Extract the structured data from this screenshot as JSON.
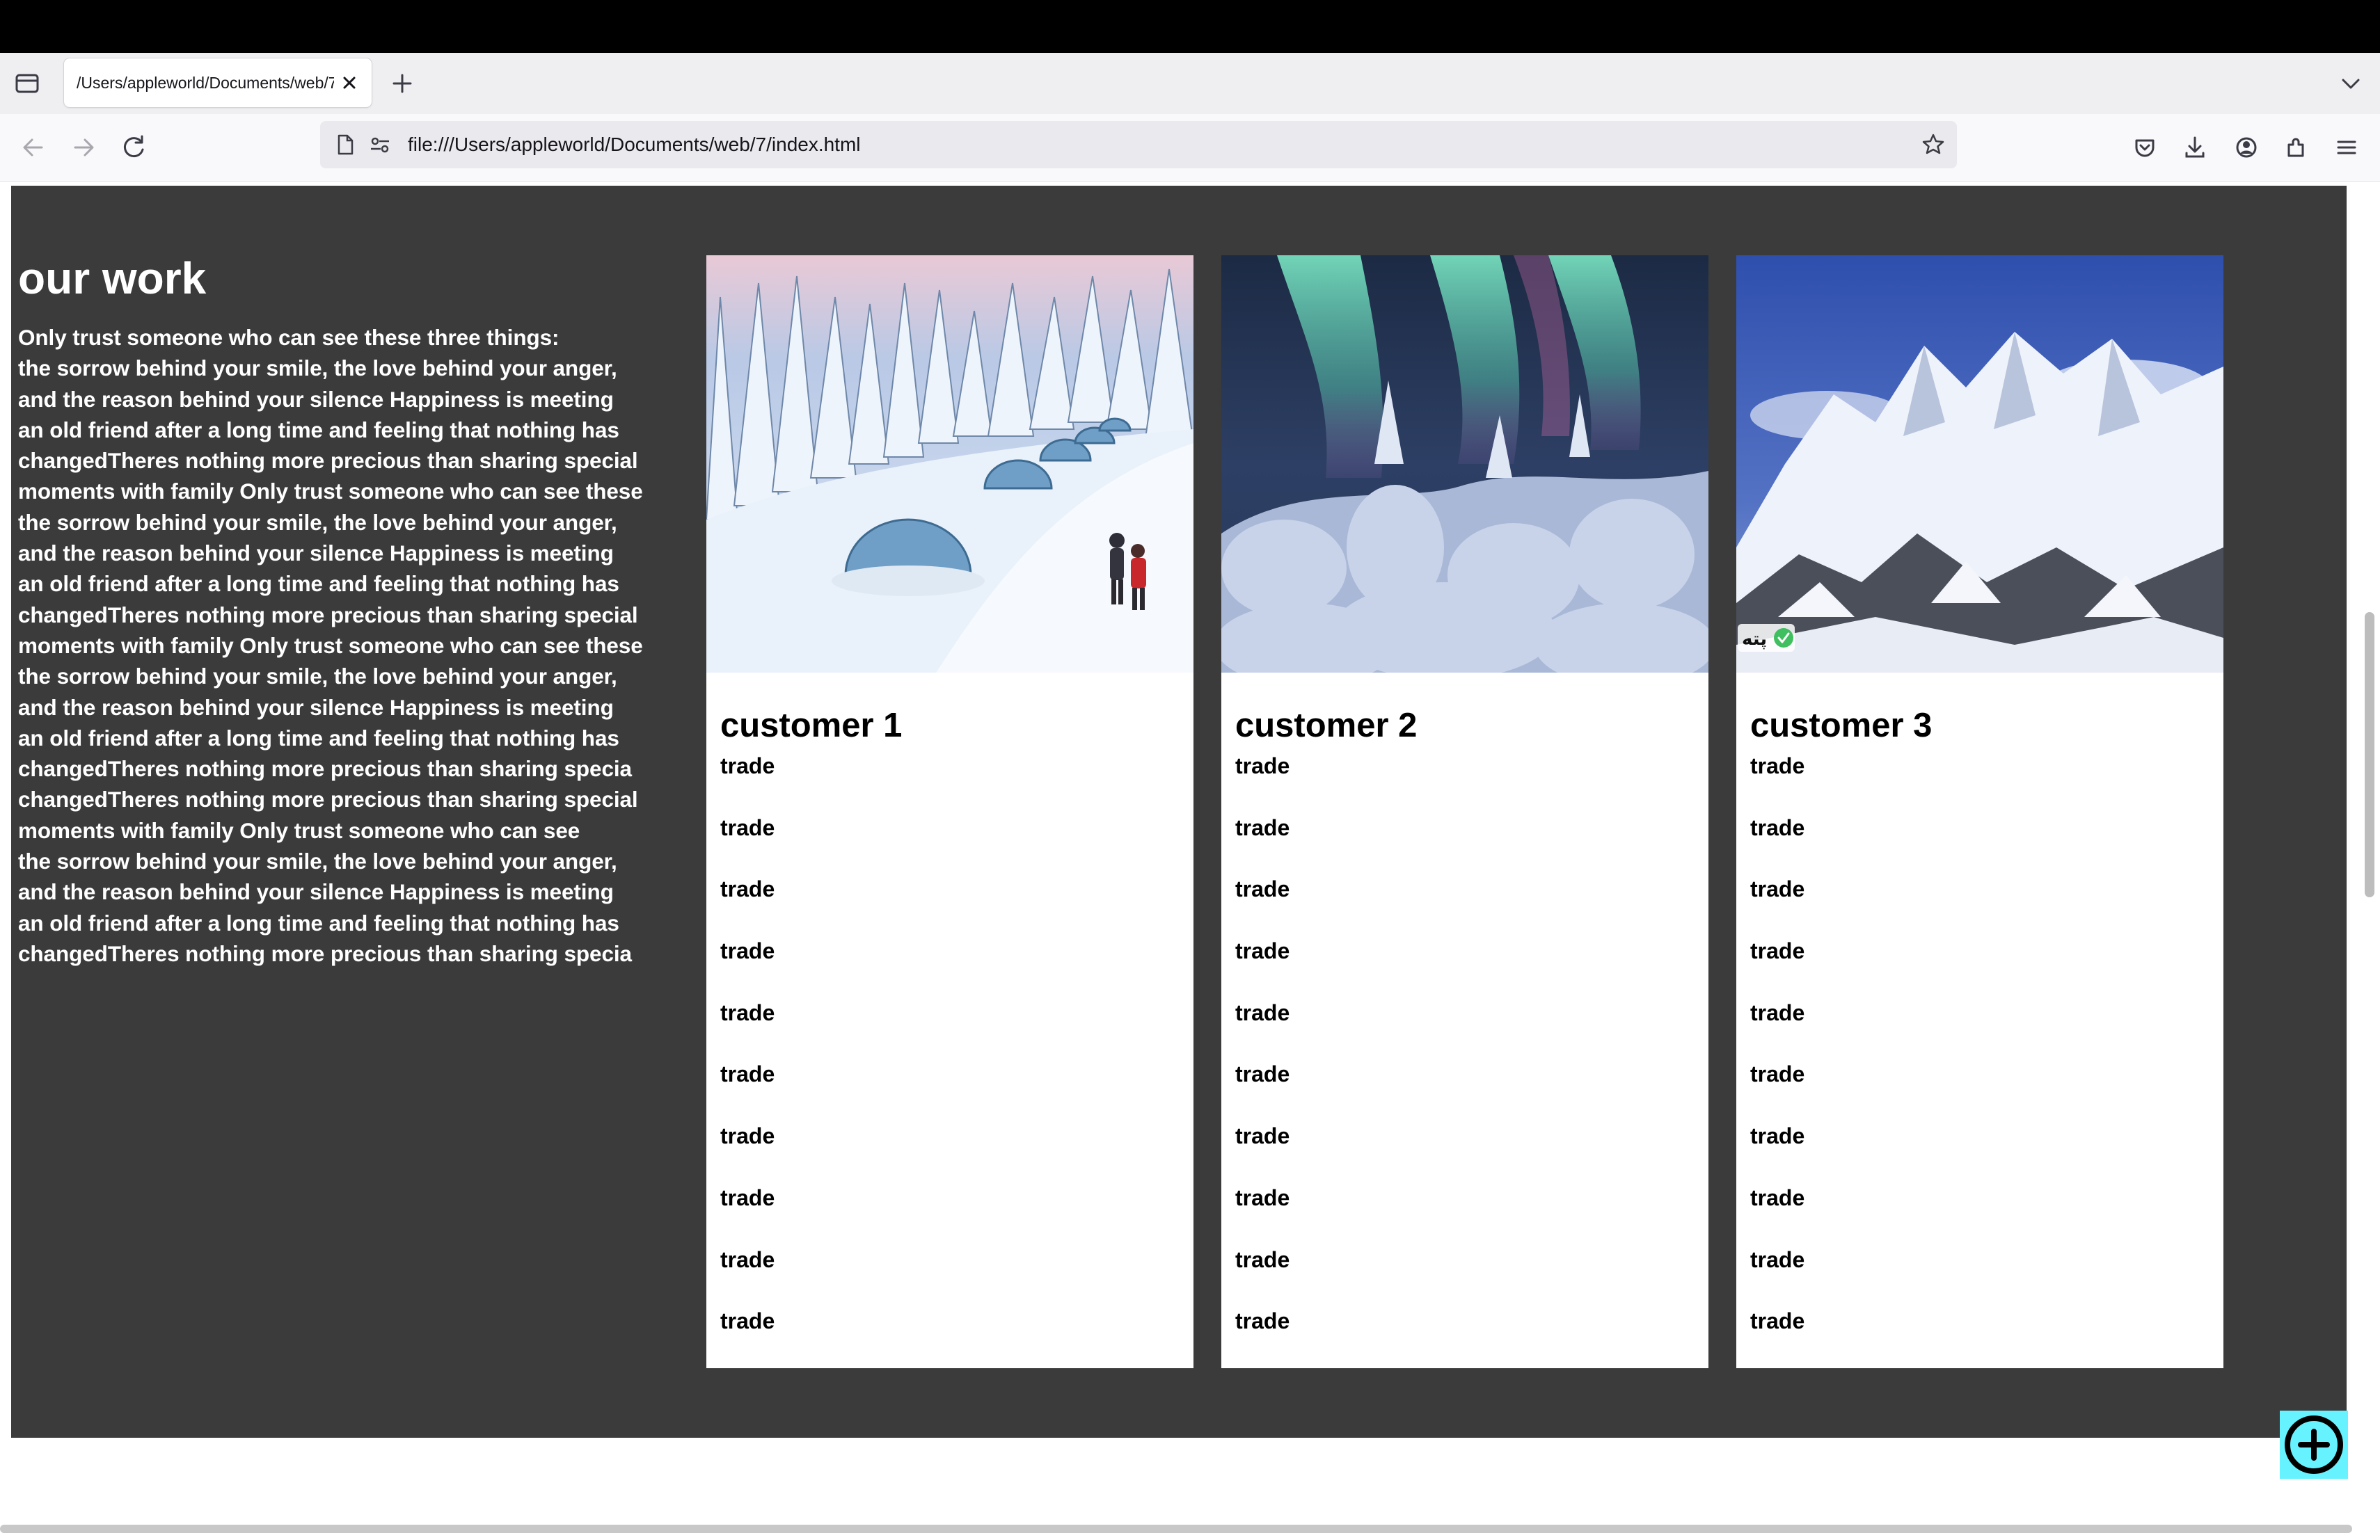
{
  "browser": {
    "tab_title": "/Users/appleworld/Documents/web/7/index.html",
    "url": "file:///Users/appleworld/Documents/web/7/index.html"
  },
  "page": {
    "heading": "our work",
    "paragraph": "Only trust someone who can see these three things:\nthe sorrow behind your smile, the love behind your anger,\nand the reason behind your silence Happiness is meeting\nan old friend after a long time and feeling that nothing has\nchangedTheres nothing more precious than sharing special\nmoments with family Only trust someone who can see these\nthe sorrow behind your smile, the love behind your anger,\nand the reason behind your silence Happiness is meeting\nan old friend after a long time and feeling that nothing has\nchangedTheres nothing more precious than sharing special\nmoments with family Only trust someone who can see these\nthe sorrow behind your smile, the love behind your anger,\nand the reason behind your silence Happiness is meeting\nan old friend after a long time and feeling that nothing has\nchangedTheres nothing more precious than sharing specia\nchangedTheres nothing more precious than sharing special\nmoments with family Only trust someone who can see\nthe sorrow behind your smile, the love behind your anger,\nand the reason behind your silence Happiness is meeting\nan old friend after a long time and feeling that nothing has\nchangedTheres nothing more precious than sharing specia",
    "cards": [
      {
        "title": "customer 1",
        "image": "snowy-igloo-village-photo",
        "items": [
          "trade",
          "trade",
          "trade",
          "trade",
          "trade",
          "trade",
          "trade",
          "trade",
          "trade",
          "trade"
        ]
      },
      {
        "title": "customer 2",
        "image": "aurora-over-snowy-forest-photo",
        "items": [
          "trade",
          "trade",
          "trade",
          "trade",
          "trade",
          "trade",
          "trade",
          "trade",
          "trade",
          "trade"
        ]
      },
      {
        "title": "customer 3",
        "image": "snowy-mountains-photo",
        "items": [
          "trade",
          "trade",
          "trade",
          "trade",
          "trade",
          "trade",
          "trade",
          "trade",
          "trade",
          "trade"
        ]
      }
    ],
    "watermark_text": "پته",
    "fab_icon": "plus-circle-icon"
  },
  "colors": {
    "section_bg": "#3b3b3b",
    "fab_bg": "#66f2ff"
  }
}
